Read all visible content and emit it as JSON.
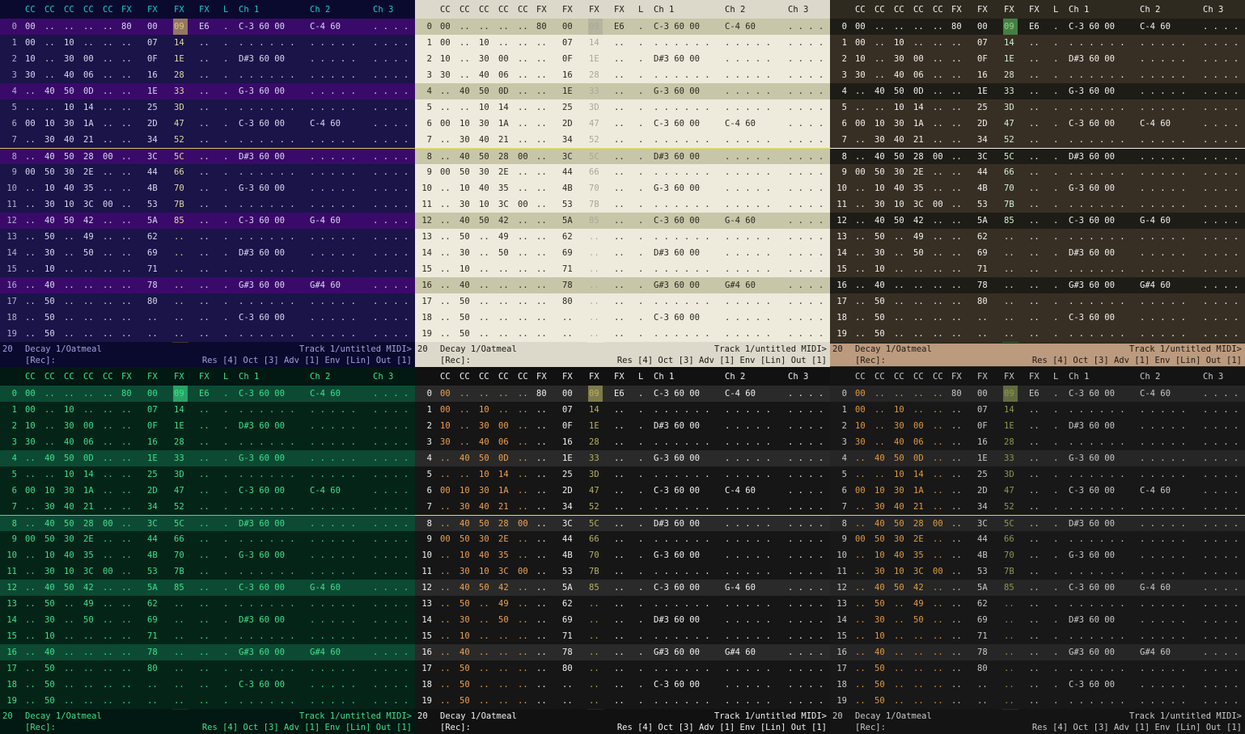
{
  "themes": [
    {
      "name": "purple",
      "bg": "#0a0a2e",
      "txt": "#d8d8f0",
      "hdr": "#1ec8c8",
      "num": "#b0b0d0",
      "beat": "#3a0a6a",
      "colBg": "#1a1448",
      "fxHl": "#6e5a2e",
      "fxTxt": "#e0d8a0",
      "cur": "#d0c060",
      "stBg": "#0a0a2e",
      "stTxt": "#a0a0e0",
      "acc": "#d0c060",
      "a": "#d8d8f0",
      "b": "#d8d8f0"
    },
    {
      "name": "oatmeal",
      "bg": "#dcd9cb",
      "txt": "#2a2a20",
      "hdr": "#1a1a14",
      "num": "#2a2a20",
      "beat": "#c8c6a8",
      "colBg": "#eeebdc",
      "fxHl": "#f4f2e6",
      "fxTxt": "#a8a898",
      "cur": "#a8a898",
      "stBg": "#dcd9cb",
      "stTxt": "#1a1a14",
      "acc": "#e0e060",
      "a": "#2a2a20",
      "b": "#2a2a20"
    },
    {
      "name": "brown",
      "bg": "#2e2a20",
      "txt": "#f0f0f0",
      "hdr": "#f0f0f0",
      "num": "#f0f0f0",
      "beat": "#1e1c16",
      "colBg": "#382f24",
      "fxHl": "#2e8a3a",
      "fxTxt": "#d0f0d0",
      "cur": "#60c060",
      "stBg": "#bc9a7e",
      "stTxt": "#1e1a14",
      "acc": "#f0f0f0",
      "a": "#f0f0f0",
      "b": "#f0f0f0"
    },
    {
      "name": "green",
      "bg": "#021812",
      "txt": "#3ee08a",
      "hdr": "#3ee08a",
      "num": "#3ee08a",
      "beat": "#0c4a34",
      "colBg": "#052418",
      "fxHl": "#1a4a2a",
      "fxTxt": "#3ee08a",
      "cur": "#3ee08a",
      "stBg": "#021812",
      "stTxt": "#3ee08a",
      "acc": "#3ee08a",
      "a": "#3ee08a",
      "b": "#3ee08a"
    },
    {
      "name": "dark",
      "bg": "#111111",
      "txt": "#f0f0f0",
      "hdr": "#f0f0f0",
      "num": "#f0f0f0",
      "beat": "#2a2a2a",
      "colBg": "#161616",
      "fxHl": "#3a3a1a",
      "fxTxt": "#b8b060",
      "cur": "#b8b060",
      "stBg": "#111111",
      "stTxt": "#f0f0f0",
      "acc": "#e0e040",
      "a": "#f0a050",
      "b": "#60a8f0"
    },
    {
      "name": "dark2",
      "bg": "#141414",
      "txt": "#c8c8c8",
      "hdr": "#c8c8c8",
      "num": "#c8c8c8",
      "beat": "#262626",
      "colBg": "#181818",
      "fxHl": "#3a4a14",
      "fxTxt": "#8a9a50",
      "cur": "#8a9a50",
      "stBg": "#141414",
      "stTxt": "#c8c8c8",
      "acc": "#d8d840",
      "a": "#e09a40",
      "b": "#7098e0"
    }
  ],
  "header_labels": [
    "CC",
    "CC",
    "CC",
    "CC",
    "CC",
    "FX",
    "FX",
    "FX",
    "FX",
    "L",
    "Ch 1",
    "Ch 2",
    "Ch 3"
  ],
  "rows": [
    {
      "n": "0",
      "c": [
        "00",
        "..",
        "..",
        "..",
        "..",
        "80",
        "00",
        "09",
        "E6",
        ".",
        "C-3 60 00",
        "C-4 60",
        ". . . ."
      ]
    },
    {
      "n": "1",
      "c": [
        "00",
        "..",
        "10",
        "..",
        "..",
        "..",
        "07",
        "14",
        "..",
        ".",
        ". . . . . .",
        ". . . . .",
        ". . . ."
      ]
    },
    {
      "n": "2",
      "c": [
        "10",
        "..",
        "30",
        "00",
        "..",
        "..",
        "0F",
        "1E",
        "..",
        ".",
        "D#3 60 00",
        ". . . . .",
        ". . . ."
      ]
    },
    {
      "n": "3",
      "c": [
        "30",
        "..",
        "40",
        "06",
        "..",
        "..",
        "16",
        "28",
        "..",
        ".",
        ". . . . . .",
        ". . . . .",
        ". . . ."
      ]
    },
    {
      "n": "4",
      "c": [
        "..",
        "40",
        "50",
        "0D",
        "..",
        "..",
        "1E",
        "33",
        "..",
        ".",
        "G-3 60 00",
        ". . . . .",
        ". . . ."
      ]
    },
    {
      "n": "5",
      "c": [
        "..",
        "..",
        "10",
        "14",
        "..",
        "..",
        "25",
        "3D",
        "..",
        ".",
        ". . . . . .",
        ". . . . .",
        ". . . ."
      ]
    },
    {
      "n": "6",
      "c": [
        "00",
        "10",
        "30",
        "1A",
        "..",
        "..",
        "2D",
        "47",
        "..",
        ".",
        "C-3 60 00",
        "C-4 60",
        ". . . ."
      ]
    },
    {
      "n": "7",
      "c": [
        "..",
        "30",
        "40",
        "21",
        "..",
        "..",
        "34",
        "52",
        "..",
        ".",
        ". . . . . .",
        ". . . . .",
        ". . . ."
      ]
    },
    {
      "n": "8",
      "c": [
        "..",
        "40",
        "50",
        "28",
        "00",
        "..",
        "3C",
        "5C",
        "..",
        ".",
        "D#3 60 00",
        ". . . . .",
        ". . . ."
      ]
    },
    {
      "n": "9",
      "c": [
        "00",
        "50",
        "30",
        "2E",
        "..",
        "..",
        "44",
        "66",
        "..",
        ".",
        ". . . . . .",
        ". . . . .",
        ". . . ."
      ]
    },
    {
      "n": "10",
      "c": [
        "..",
        "10",
        "40",
        "35",
        "..",
        "..",
        "4B",
        "70",
        "..",
        ".",
        "G-3 60 00",
        ". . . . .",
        ". . . ."
      ]
    },
    {
      "n": "11",
      "c": [
        "..",
        "30",
        "10",
        "3C",
        "00",
        "..",
        "53",
        "7B",
        "..",
        ".",
        ". . . . . .",
        ". . . . .",
        ". . . ."
      ]
    },
    {
      "n": "12",
      "c": [
        "..",
        "40",
        "50",
        "42",
        "..",
        "..",
        "5A",
        "85",
        "..",
        ".",
        "C-3 60 00",
        "G-4 60",
        ". . . ."
      ]
    },
    {
      "n": "13",
      "c": [
        "..",
        "50",
        "..",
        "49",
        "..",
        "..",
        "62",
        "..",
        "..",
        ".",
        ". . . . . .",
        ". . . . .",
        ". . . ."
      ]
    },
    {
      "n": "14",
      "c": [
        "..",
        "30",
        "..",
        "50",
        "..",
        "..",
        "69",
        "..",
        "..",
        ".",
        "D#3 60 00",
        ". . . . .",
        ". . . ."
      ]
    },
    {
      "n": "15",
      "c": [
        "..",
        "10",
        "..",
        "..",
        "..",
        "..",
        "71",
        "..",
        "..",
        ".",
        ". . . . . .",
        ". . . . .",
        ". . . ."
      ]
    },
    {
      "n": "16",
      "c": [
        "..",
        "40",
        "..",
        "..",
        "..",
        "..",
        "78",
        "..",
        "..",
        ".",
        "G#3 60 00",
        "G#4 60",
        ". . . ."
      ]
    },
    {
      "n": "17",
      "c": [
        "..",
        "50",
        "..",
        "..",
        "..",
        "..",
        "80",
        "..",
        "..",
        ".",
        ". . . . . .",
        ". . . . .",
        ". . . ."
      ]
    },
    {
      "n": "18",
      "c": [
        "..",
        "50",
        "..",
        "..",
        "..",
        "..",
        "..",
        "..",
        "..",
        ".",
        "C-3 60 00",
        ". . . . .",
        ". . . ."
      ]
    },
    {
      "n": "19",
      "c": [
        "..",
        "50",
        "..",
        "..",
        "..",
        "..",
        "..",
        "..",
        "..",
        ".",
        ". . . . . .",
        ". . . . .",
        ". . . ."
      ]
    }
  ],
  "status": {
    "row_num": "20",
    "left_top": "Decay 1/Oatmeal",
    "right_top": "Track 1/untitled MIDI>",
    "left_bottom": "[Rec]:",
    "right_bottom": "Res [4] Oct [3] Adv [1] Env [Lin] Out [1]"
  }
}
